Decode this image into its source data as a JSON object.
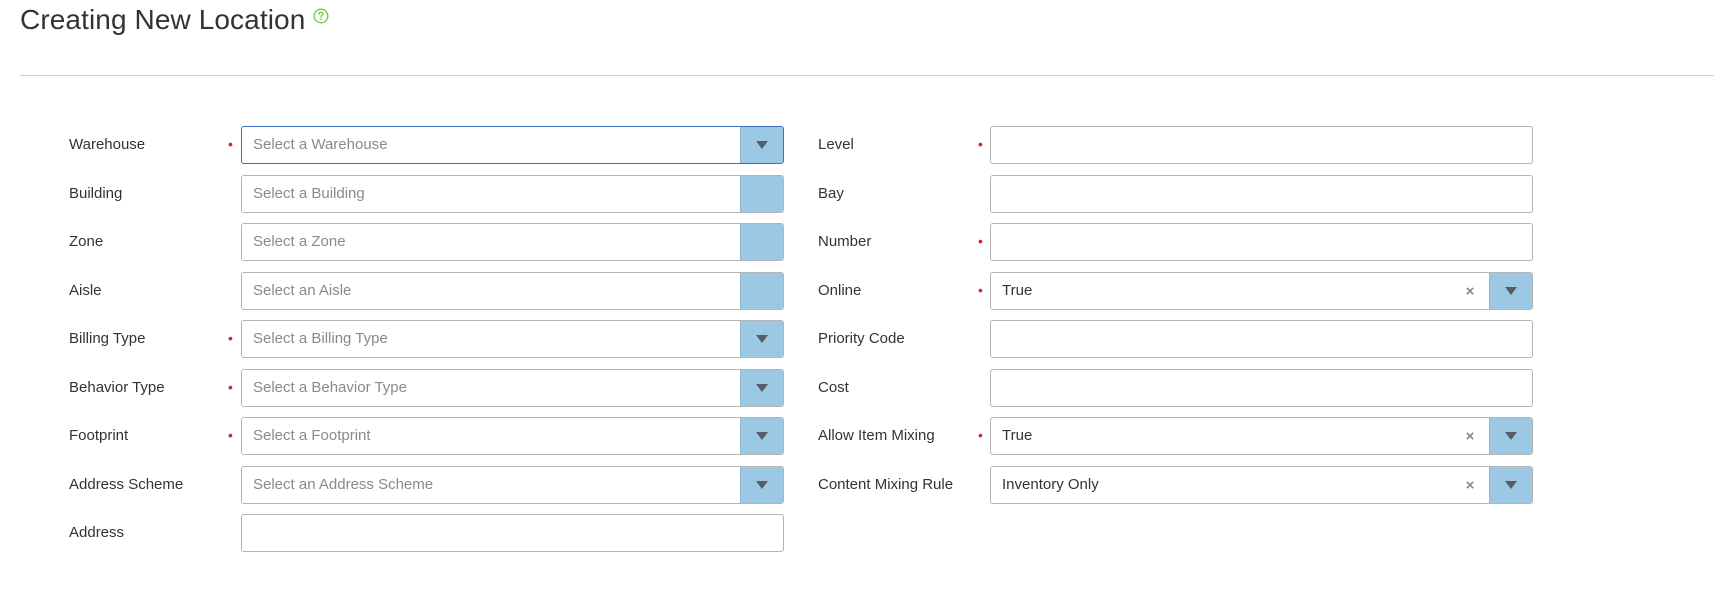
{
  "header": {
    "title": "Creating New Location"
  },
  "colors": {
    "dropdown_button": "#9cc8e6",
    "required_marker": "#e02020",
    "help_icon": "#7ac943",
    "focus_border": "#3a6fc4"
  },
  "left_fields": {
    "warehouse": {
      "label": "Warehouse",
      "required": "•",
      "placeholder": "Select a Warehouse"
    },
    "building": {
      "label": "Building",
      "placeholder": "Select a Building"
    },
    "zone": {
      "label": "Zone",
      "placeholder": "Select a Zone"
    },
    "aisle": {
      "label": "Aisle",
      "placeholder": "Select an Aisle"
    },
    "billing_type": {
      "label": "Billing Type",
      "required": "•",
      "placeholder": "Select a Billing Type"
    },
    "behavior_type": {
      "label": "Behavior Type",
      "required": "•",
      "placeholder": "Select a Behavior Type"
    },
    "footprint": {
      "label": "Footprint",
      "required": "•",
      "placeholder": "Select a Footprint"
    },
    "address_scheme": {
      "label": "Address Scheme",
      "placeholder": "Select an Address Scheme"
    },
    "address": {
      "label": "Address",
      "value": ""
    }
  },
  "right_fields": {
    "level": {
      "label": "Level",
      "required": "•",
      "value": ""
    },
    "bay": {
      "label": "Bay",
      "value": ""
    },
    "number": {
      "label": "Number",
      "required": "•",
      "value": ""
    },
    "online": {
      "label": "Online",
      "required": "•",
      "value": "True",
      "clear": "×"
    },
    "priority_code": {
      "label": "Priority Code",
      "value": ""
    },
    "cost": {
      "label": "Cost",
      "value": ""
    },
    "allow_item_mixing": {
      "label": "Allow Item Mixing",
      "required": "•",
      "value": "True",
      "clear": "×"
    },
    "content_mixing_rule": {
      "label": "Content Mixing Rule",
      "value": "Inventory Only",
      "clear": "×"
    }
  },
  "icons": {
    "help": "help-circle-icon",
    "dropdown": "caret-down-icon",
    "clear": "clear-x-icon"
  }
}
